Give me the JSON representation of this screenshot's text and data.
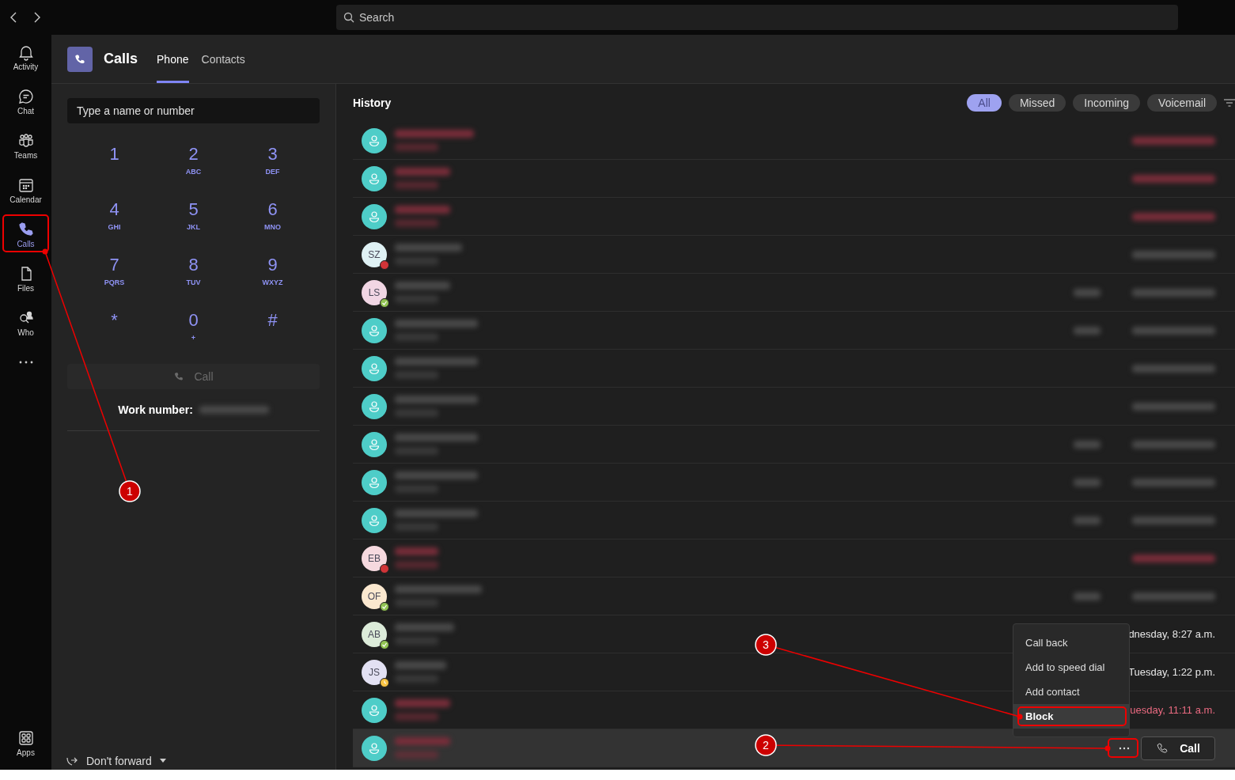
{
  "search": {
    "placeholder": "Search"
  },
  "rail": [
    {
      "kind": "activity",
      "label": "Activity",
      "selected": false
    },
    {
      "kind": "chat",
      "label": "Chat",
      "selected": false
    },
    {
      "kind": "teams",
      "label": "Teams",
      "selected": false
    },
    {
      "kind": "calendar",
      "label": "Calendar",
      "selected": false
    },
    {
      "kind": "calls",
      "label": "Calls",
      "selected": true
    },
    {
      "kind": "files",
      "label": "Files",
      "selected": false
    },
    {
      "kind": "who",
      "label": "Who",
      "selected": false
    }
  ],
  "rail_bottom": {
    "label": "Apps"
  },
  "header": {
    "title": "Calls",
    "tabs": [
      {
        "label": "Phone",
        "selected": true
      },
      {
        "label": "Contacts",
        "selected": false
      }
    ]
  },
  "dialer": {
    "placeholder": "Type a name or number",
    "keys": [
      {
        "digit": "1"
      },
      {
        "digit": "2",
        "letters": "ABC"
      },
      {
        "digit": "3",
        "letters": "DEF"
      },
      {
        "digit": "4",
        "letters": "GHI"
      },
      {
        "digit": "5",
        "letters": "JKL"
      },
      {
        "digit": "6",
        "letters": "MNO"
      },
      {
        "digit": "7",
        "letters": "PQRS"
      },
      {
        "digit": "8",
        "letters": "TUV"
      },
      {
        "digit": "9",
        "letters": "WXYZ"
      },
      {
        "digit": "*"
      },
      {
        "digit": "0",
        "letters": "+"
      },
      {
        "digit": "#"
      }
    ],
    "call_button": {
      "label": "Call",
      "disabled": true
    },
    "work_number_label": "Work number:",
    "forward": "Don't forward"
  },
  "history": {
    "title": "History",
    "filters": [
      {
        "label": "All",
        "selected": true
      },
      {
        "label": "Missed",
        "selected": false
      },
      {
        "label": "Incoming",
        "selected": false
      },
      {
        "label": "Voicemail",
        "selected": false
      }
    ],
    "rows": [
      {
        "avatar": {
          "kind": "generic"
        },
        "missed": true,
        "duration_shown": false,
        "selected": false
      },
      {
        "avatar": {
          "kind": "generic"
        },
        "missed": true,
        "duration_shown": false,
        "selected": false
      },
      {
        "avatar": {
          "kind": "generic"
        },
        "missed": true,
        "duration_shown": false,
        "selected": false
      },
      {
        "avatar": {
          "kind": "initials",
          "initials": "SZ",
          "color": "#dff1f4",
          "presence": {
            "kind": "busy",
            "color": "#d13438"
          }
        },
        "missed": false,
        "duration_shown": false,
        "selected": false
      },
      {
        "avatar": {
          "kind": "initials",
          "initials": "LS",
          "color": "#f1d6e4",
          "presence": {
            "kind": "available",
            "color": "#92c353"
          }
        },
        "missed": false,
        "duration_shown": true,
        "selected": false
      },
      {
        "avatar": {
          "kind": "generic"
        },
        "missed": false,
        "duration_shown": true,
        "selected": false
      },
      {
        "avatar": {
          "kind": "generic"
        },
        "missed": false,
        "duration_shown": false,
        "selected": false
      },
      {
        "avatar": {
          "kind": "generic"
        },
        "missed": false,
        "duration_shown": false,
        "selected": false
      },
      {
        "avatar": {
          "kind": "generic"
        },
        "missed": false,
        "duration_shown": true,
        "selected": false
      },
      {
        "avatar": {
          "kind": "generic"
        },
        "missed": false,
        "duration_shown": true,
        "selected": false
      },
      {
        "avatar": {
          "kind": "generic"
        },
        "missed": false,
        "duration_shown": true,
        "selected": false
      },
      {
        "avatar": {
          "kind": "initials",
          "initials": "EB",
          "color": "#f6d9df",
          "presence": {
            "kind": "busy",
            "color": "#d13438"
          }
        },
        "missed": true,
        "duration_shown": false,
        "selected": false
      },
      {
        "avatar": {
          "kind": "initials",
          "initials": "OF",
          "color": "#fbe8cf",
          "presence": {
            "kind": "available",
            "color": "#92c353"
          }
        },
        "missed": false,
        "duration_shown": true,
        "selected": false
      },
      {
        "avatar": {
          "kind": "initials",
          "initials": "AB",
          "color": "#dcebd9",
          "presence": {
            "kind": "available",
            "color": "#92c353"
          }
        },
        "missed": false,
        "duration_shown": false,
        "selected": false,
        "time": "dnesday, 8:27 a.m."
      },
      {
        "avatar": {
          "kind": "initials",
          "initials": "JS",
          "color": "#e3e1f3",
          "presence": {
            "kind": "away",
            "color": "#f8c344"
          }
        },
        "missed": false,
        "duration_shown": false,
        "selected": false,
        "time": "Tuesday, 1:22 p.m."
      },
      {
        "avatar": {
          "kind": "generic"
        },
        "missed": true,
        "duration_shown": false,
        "selected": false,
        "time": "uesday, 11:11 a.m."
      },
      {
        "avatar": {
          "kind": "generic"
        },
        "missed": true,
        "duration_shown": false,
        "selected": true
      }
    ],
    "row_call_button": "Call"
  },
  "context_menu": [
    {
      "label": "Call back",
      "selected": false
    },
    {
      "label": "Add to speed dial",
      "selected": false
    },
    {
      "label": "Add contact",
      "selected": false
    },
    {
      "label": "Block",
      "selected": true
    }
  ],
  "annotations": [
    {
      "number": "1"
    },
    {
      "number": "2"
    },
    {
      "number": "3"
    }
  ]
}
